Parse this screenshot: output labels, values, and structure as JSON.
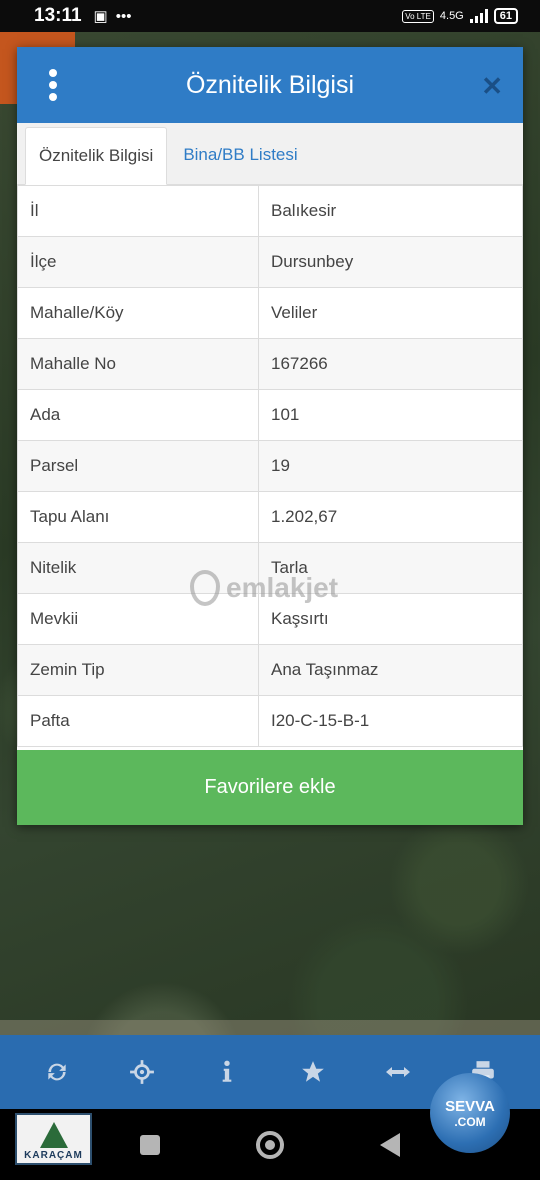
{
  "status_bar": {
    "time": "13:11",
    "network": "4.5G",
    "volte": "Vo LTE",
    "battery": "61"
  },
  "dialog": {
    "title": "Öznitelik Bilgisi",
    "tabs": [
      {
        "label": "Öznitelik Bilgisi",
        "active": true
      },
      {
        "label": "Bina/BB Listesi",
        "active": false
      }
    ],
    "rows": [
      {
        "key": "İl",
        "value": "Balıkesir"
      },
      {
        "key": "İlçe",
        "value": "Dursunbey"
      },
      {
        "key": "Mahalle/Köy",
        "value": "Veliler"
      },
      {
        "key": "Mahalle No",
        "value": "167266"
      },
      {
        "key": "Ada",
        "value": "101"
      },
      {
        "key": "Parsel",
        "value": "19"
      },
      {
        "key": "Tapu Alanı",
        "value": "1.202,67"
      },
      {
        "key": "Nitelik",
        "value": "Tarla"
      },
      {
        "key": "Mevkii",
        "value": "Kaşsırtı"
      },
      {
        "key": "Zemin Tip",
        "value": "Ana Taşınmaz"
      },
      {
        "key": "Pafta",
        "value": "I20-C-15-B-1"
      }
    ],
    "favorite_button": "Favorilere ekle"
  },
  "watermark": "emlakjet",
  "toolbar": {
    "icons": [
      "refresh-icon",
      "locate-icon",
      "info-icon",
      "star-icon",
      "measure-icon",
      "print-icon"
    ]
  },
  "logos": {
    "left": "KARAÇAM",
    "right_line1": "SEVVA",
    "right_line2": ".COM"
  },
  "colors": {
    "header_blue": "#2f7cc6",
    "button_green": "#5cb85c",
    "toolbar_blue": "#2a6cb0"
  }
}
